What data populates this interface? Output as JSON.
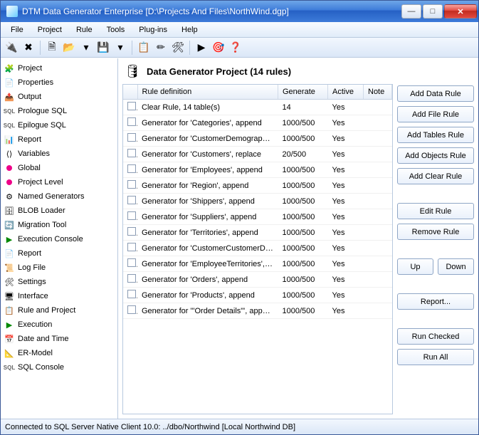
{
  "titlebar": {
    "app_name": "DTM Data Generator Enterprise",
    "project_path": "[D:\\Projects And Files\\NorthWind.dgp]"
  },
  "menubar": [
    "File",
    "Project",
    "Rule",
    "Tools",
    "Plug-ins",
    "Help"
  ],
  "toolbar_icons": [
    {
      "name": "connect-icon",
      "glyph": "🔌"
    },
    {
      "name": "disconnect-icon",
      "glyph": "✖"
    },
    {
      "name": "divider"
    },
    {
      "name": "new-icon",
      "glyph": "🗎"
    },
    {
      "name": "open-icon",
      "glyph": "📂"
    },
    {
      "name": "dropdown-icon",
      "glyph": "▾"
    },
    {
      "name": "save-icon",
      "glyph": "💾"
    },
    {
      "name": "dropdown2-icon",
      "glyph": "▾"
    },
    {
      "name": "divider"
    },
    {
      "name": "rule-icon",
      "glyph": "📋"
    },
    {
      "name": "edit-icon",
      "glyph": "✏"
    },
    {
      "name": "settings-icon",
      "glyph": "🛠"
    },
    {
      "name": "divider"
    },
    {
      "name": "run-icon",
      "glyph": "▶"
    },
    {
      "name": "target-icon",
      "glyph": "🎯"
    },
    {
      "name": "help-icon",
      "glyph": "❓"
    }
  ],
  "sidebar": {
    "items": [
      {
        "label": "Project",
        "icon": "🧩",
        "level": 0
      },
      {
        "label": "Properties",
        "icon": "📄",
        "level": 1
      },
      {
        "label": "Output",
        "icon": "📤",
        "level": 1
      },
      {
        "label": "Prologue SQL",
        "icon": "SQL",
        "level": 1
      },
      {
        "label": "Epilogue SQL",
        "icon": "SQL",
        "level": 1
      },
      {
        "label": "Report",
        "icon": "📊",
        "level": 1
      },
      {
        "label": "Variables",
        "icon": "⟨⟩",
        "level": 0
      },
      {
        "label": "Global",
        "icon": "●",
        "level": 1,
        "color": "#e08"
      },
      {
        "label": "Project Level",
        "icon": "●",
        "level": 1,
        "color": "#e08"
      },
      {
        "label": "Named Generators",
        "icon": "⚙",
        "level": 0
      },
      {
        "label": "BLOB Loader",
        "icon": "🗄",
        "level": 0
      },
      {
        "label": "Migration Tool",
        "icon": "🔄",
        "level": 0
      },
      {
        "label": "Execution Console",
        "icon": "▶",
        "level": 0,
        "color": "#080"
      },
      {
        "label": "Report",
        "icon": "📄",
        "level": 1
      },
      {
        "label": "Log File",
        "icon": "📜",
        "level": 1
      },
      {
        "label": "Settings",
        "icon": "🛠",
        "level": 0
      },
      {
        "label": "Interface",
        "icon": "🖥",
        "level": 1
      },
      {
        "label": "Rule and Project",
        "icon": "📋",
        "level": 1
      },
      {
        "label": "Execution",
        "icon": "▶",
        "level": 1,
        "color": "#080"
      },
      {
        "label": "Date and Time",
        "icon": "📅",
        "level": 1
      },
      {
        "label": "ER-Model",
        "icon": "📐",
        "level": 0
      },
      {
        "label": "SQL Console",
        "icon": "SQL",
        "level": 0
      }
    ]
  },
  "content": {
    "title": "Data Generator Project (14 rules)",
    "columns": [
      "Rule definition",
      "Generate",
      "Active",
      "Note"
    ],
    "rows": [
      {
        "def": "Clear Rule, 14 table(s)",
        "gen": "14",
        "active": "Yes",
        "note": ""
      },
      {
        "def": "Generator for 'Categories', append",
        "gen": "1000/500",
        "active": "Yes",
        "note": ""
      },
      {
        "def": "Generator for 'CustomerDemographics', append",
        "gen": "1000/500",
        "active": "Yes",
        "note": ""
      },
      {
        "def": "Generator for 'Customers', replace",
        "gen": "20/500",
        "active": "Yes",
        "note": ""
      },
      {
        "def": "Generator for 'Employees', append",
        "gen": "1000/500",
        "active": "Yes",
        "note": ""
      },
      {
        "def": "Generator for 'Region', append",
        "gen": "1000/500",
        "active": "Yes",
        "note": ""
      },
      {
        "def": "Generator for 'Shippers', append",
        "gen": "1000/500",
        "active": "Yes",
        "note": ""
      },
      {
        "def": "Generator for 'Suppliers', append",
        "gen": "1000/500",
        "active": "Yes",
        "note": ""
      },
      {
        "def": "Generator for 'Territories', append",
        "gen": "1000/500",
        "active": "Yes",
        "note": ""
      },
      {
        "def": "Generator for 'CustomerCustomerDemo', append",
        "gen": "1000/500",
        "active": "Yes",
        "note": ""
      },
      {
        "def": "Generator for 'EmployeeTerritories', append",
        "gen": "1000/500",
        "active": "Yes",
        "note": ""
      },
      {
        "def": "Generator for 'Orders', append",
        "gen": "1000/500",
        "active": "Yes",
        "note": ""
      },
      {
        "def": "Generator for 'Products', append",
        "gen": "1000/500",
        "active": "Yes",
        "note": ""
      },
      {
        "def": "Generator for '\"Order Details\"', append",
        "gen": "1000/500",
        "active": "Yes",
        "note": ""
      }
    ]
  },
  "buttons": {
    "add_data": "Add Data Rule",
    "add_file": "Add File Rule",
    "add_tables": "Add Tables Rule",
    "add_objects": "Add Objects Rule",
    "add_clear": "Add Clear Rule",
    "edit": "Edit Rule",
    "remove": "Remove Rule",
    "up": "Up",
    "down": "Down",
    "report": "Report...",
    "run_checked": "Run Checked",
    "run_all": "Run All"
  },
  "statusbar": {
    "text": "Connected to SQL Server Native Client 10.0: ../dbo/Northwind [Local Northwind DB]"
  }
}
